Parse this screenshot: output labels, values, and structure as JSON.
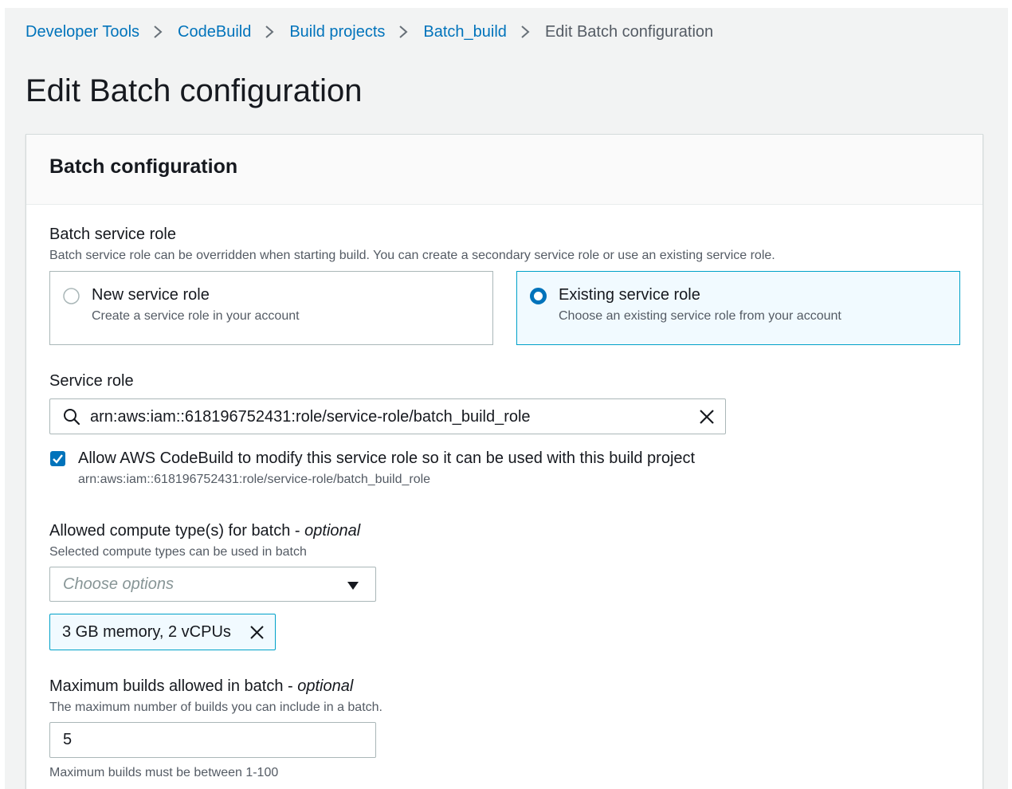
{
  "breadcrumb": {
    "items": [
      "Developer Tools",
      "CodeBuild",
      "Build projects",
      "Batch_build"
    ],
    "current": "Edit Batch configuration"
  },
  "page": {
    "title": "Edit Batch configuration"
  },
  "container": {
    "title": "Batch configuration"
  },
  "batch_service_role": {
    "label": "Batch service role",
    "description": "Batch service role can be overridden when starting build. You can create a secondary service role or use an existing service role.",
    "options": [
      {
        "title": "New service role",
        "description": "Create a service role in your account",
        "selected": false
      },
      {
        "title": "Existing service role",
        "description": "Choose an existing service role from your account",
        "selected": true
      }
    ]
  },
  "service_role": {
    "label": "Service role",
    "value": "arn:aws:iam::618196752431:role/service-role/batch_build_role"
  },
  "allow_modify": {
    "checked": true,
    "label": "Allow AWS CodeBuild to modify this service role so it can be used with this build project",
    "sublabel": "arn:aws:iam::618196752431:role/service-role/batch_build_role"
  },
  "compute_types": {
    "label": "Allowed compute type(s) for batch",
    "optional_sep": " - ",
    "optional": "optional",
    "description": "Selected compute types can be used in batch",
    "placeholder": "Choose options",
    "tokens": [
      "3 GB memory, 2 vCPUs"
    ]
  },
  "max_builds": {
    "label": "Maximum builds allowed in batch",
    "optional_sep": " - ",
    "optional": "optional",
    "description": "The maximum number of builds you can include in a batch.",
    "value": "5",
    "constraint": "Maximum builds must be between 1-100"
  },
  "colors": {
    "link": "#0073bb",
    "selected_border": "#00a1c9",
    "selected_bg": "#f1faff",
    "page_bg": "#f2f3f3"
  },
  "icons": {
    "breadcrumb_separator": "chevron-right-icon",
    "search": "search-icon",
    "clear": "close-icon",
    "select_caret": "caret-down-icon",
    "token_dismiss": "close-icon",
    "checkbox": "check-icon"
  }
}
